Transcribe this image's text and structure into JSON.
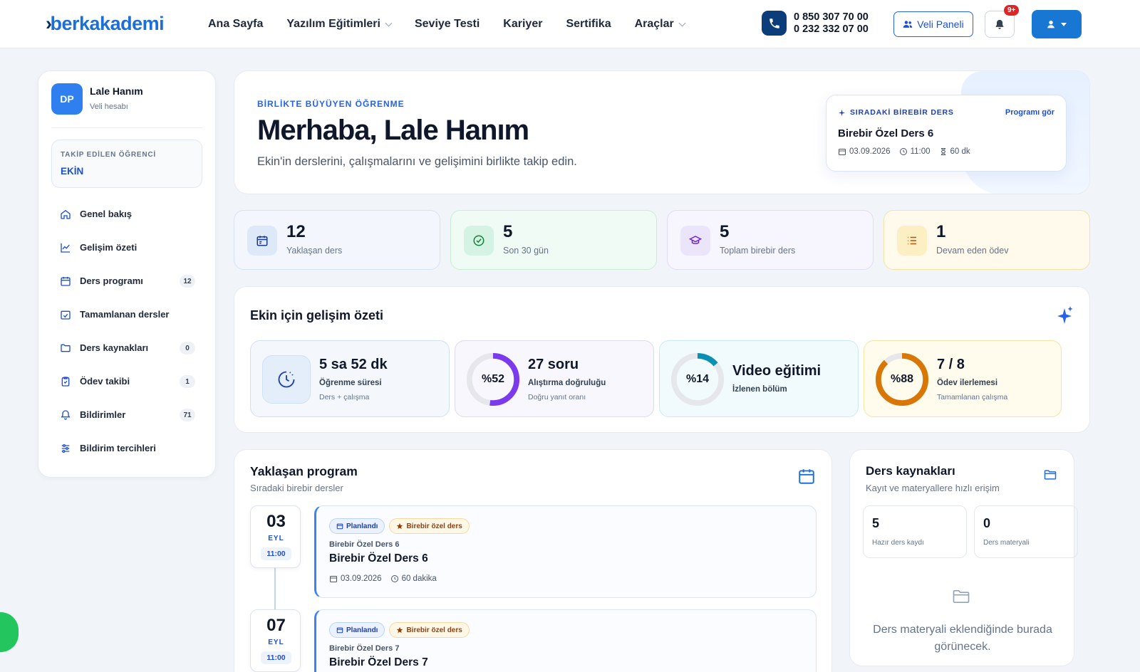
{
  "header": {
    "logo": "berkakademi",
    "nav": [
      {
        "label": "Ana Sayfa",
        "dropdown": false
      },
      {
        "label": "Yazılım Eğitimleri",
        "dropdown": true
      },
      {
        "label": "Seviye Testi",
        "dropdown": false
      },
      {
        "label": "Kariyer",
        "dropdown": false
      },
      {
        "label": "Sertifika",
        "dropdown": false
      },
      {
        "label": "Araçlar",
        "dropdown": true
      }
    ],
    "phone_1": "0 850 307 70 00",
    "phone_2": "0 232 332 07 00",
    "parent_panel": "Veli Paneli",
    "notification_badge": "9+"
  },
  "sidebar": {
    "initials": "DP",
    "name": "Lale Hanım",
    "role": "Veli hesabı",
    "tracked_label": "TAKİP EDİLEN ÖĞRENCİ",
    "tracked_student": "EKİN",
    "items": [
      {
        "label": "Genel bakış",
        "icon": "home-icon",
        "count": ""
      },
      {
        "label": "Gelişim özeti",
        "icon": "chart-line-icon",
        "count": ""
      },
      {
        "label": "Ders programı",
        "icon": "calendar-icon",
        "count": "12"
      },
      {
        "label": "Tamamlanan dersler",
        "icon": "calendar-check-icon",
        "count": ""
      },
      {
        "label": "Ders kaynakları",
        "icon": "folder-icon",
        "count": "0"
      },
      {
        "label": "Ödev takibi",
        "icon": "clipboard-icon",
        "count": "1"
      },
      {
        "label": "Bildirimler",
        "icon": "bell-icon",
        "count": "71"
      },
      {
        "label": "Bildirim tercihleri",
        "icon": "sliders-icon",
        "count": ""
      }
    ]
  },
  "hero": {
    "eyebrow": "BİRLİKTE BÜYÜYEN ÖĞRENME",
    "title": "Merhaba, Lale Hanım",
    "subtitle": "Ekin'in derslerini, çalışmalarını ve gelişimini birlikte takip edin.",
    "next": {
      "eyebrow": "SIRADAKİ BİREBİR DERS",
      "link": "Programı gör",
      "title": "Birebir Özel Ders 6",
      "date": "03.09.2026",
      "time": "11:00",
      "duration": "60 dk"
    }
  },
  "stats": [
    {
      "value": "12",
      "label": "Yaklaşan ders",
      "icon": "calendar-icon"
    },
    {
      "value": "5",
      "label": "Son 30 gün",
      "icon": "check-circle-icon"
    },
    {
      "value": "5",
      "label": "Toplam birebir ders",
      "icon": "graduation-cap-icon"
    },
    {
      "value": "1",
      "label": "Devam eden ödev",
      "icon": "list-icon"
    }
  ],
  "summary": {
    "title": "Ekin için gelişim özeti",
    "metrics": [
      {
        "value": "5 sa 52 dk",
        "label": "Öğrenme süresi",
        "sub": "Ders + çalışma",
        "percent": null
      },
      {
        "value": "27 soru",
        "label": "Alıştırma doğruluğu",
        "sub": "Doğru yanıt oranı",
        "percent": 52,
        "percent_text": "%52",
        "color": "#7c3aed"
      },
      {
        "value": "Video eğitimi",
        "label": "İzlenen bölüm",
        "sub": "",
        "percent": 14,
        "percent_text": "%14",
        "color": "#0891b2"
      },
      {
        "value": "7 / 8",
        "label": "Ödev ilerlemesi",
        "sub": "Tamamlanan çalışma",
        "percent": 88,
        "percent_text": "%88",
        "color": "#d97706"
      }
    ]
  },
  "program": {
    "title": "Yaklaşan program",
    "subtitle": "Sıradaki birebir dersler",
    "lessons": [
      {
        "day": "03",
        "month": "EYL",
        "time": "11:00",
        "status": "Planlandı",
        "type": "Birebir özel ders",
        "small": "Birebir Özel Ders 6",
        "title": "Birebir Özel Ders 6",
        "date": "03.09.2026",
        "duration": "60 dakika"
      },
      {
        "day": "07",
        "month": "EYL",
        "time": "11:00",
        "status": "Planlandı",
        "type": "Birebir özel ders",
        "small": "Birebir Özel Ders 7",
        "title": "Birebir Özel Ders 7",
        "date": "",
        "duration": ""
      }
    ]
  },
  "resources": {
    "title": "Ders kaynakları",
    "subtitle": "Kayıt ve materyallere hızlı erişim",
    "recordings_count": "5",
    "recordings_label": "Hazır ders kaydı",
    "materials_count": "0",
    "materials_label": "Ders materyali",
    "empty_text": "Ders materyali eklendiğinde burada görünecek."
  },
  "colors": {
    "brand": "#1d6fd8",
    "accent": "#1877d2",
    "danger": "#dc2626"
  }
}
